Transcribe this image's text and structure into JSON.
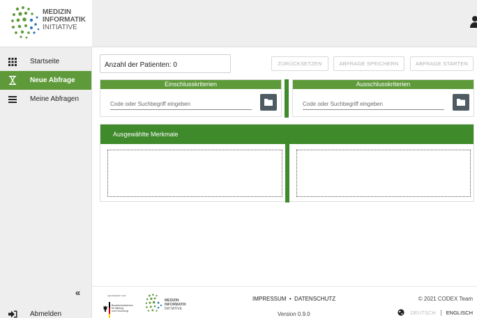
{
  "logo": {
    "line1": "MEDIZIN",
    "line2": "INFORMATIK",
    "line3": "INITIATIVE"
  },
  "sidebar": {
    "items": [
      {
        "label": "Startseite",
        "icon": "grid-icon"
      },
      {
        "label": "Neue Abfrage",
        "icon": "hourglass-icon",
        "active": true
      },
      {
        "label": "Meine Abfragen",
        "icon": "list-icon"
      }
    ],
    "collapse_label": "«",
    "logout_label": "Abmelden"
  },
  "topbar": {
    "user_icon": "user-icon"
  },
  "main": {
    "patient_count_label": "Anzahl der Patienten: 0",
    "buttons": {
      "reset": "ZURÜCKSETZEN",
      "save": "ABFRAGE SPEICHERN",
      "start": "ABFRAGE STARTEN"
    },
    "inclusion": {
      "title": "Einschlusskriterien",
      "placeholder": "Code oder Suchbegriff eingeben"
    },
    "exclusion": {
      "title": "Ausschlusskriterien",
      "placeholder": "Code oder Suchbegriff eingeben"
    },
    "selected_title": "Ausgewählte Merkmale"
  },
  "footer": {
    "sponsor_small": "GEFÖRDERT VOM",
    "sponsor_line1": "Bundesministerium",
    "sponsor_line2": "für Bildung",
    "sponsor_line3": "und Forschung",
    "logo_line1": "MEDIZIN",
    "logo_line2": "INFORMATIK",
    "logo_line3": "INITIATIVE",
    "link_impressum": "IMPRESSUM",
    "link_sep": "•",
    "link_datenschutz": "DATENSCHUTZ",
    "version": "Version 0.9.0",
    "copyright": "© 2021 CODEX Team",
    "lang_de": "DEUTSCH",
    "lang_en": "ENGLISCH"
  },
  "colors": {
    "accent": "#5e9a3a",
    "accent_dark": "#3f8a2b",
    "folder_button": "#4f5b62"
  }
}
